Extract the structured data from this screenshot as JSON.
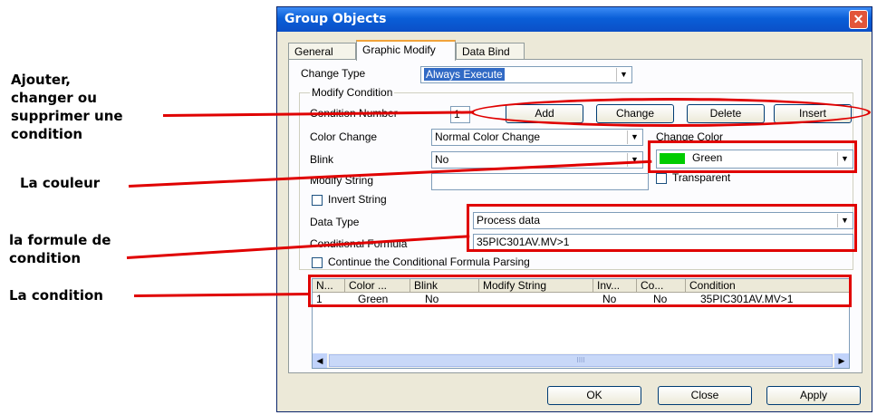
{
  "annotations": {
    "add_change_delete": "Ajouter,\nchanger ou\nsupprimer une\ncondition",
    "color": "La couleur",
    "formula": "la formule de\ncondition",
    "condition": "La condition"
  },
  "window": {
    "title": "Group Objects",
    "close_glyph": "✕"
  },
  "tabs": [
    {
      "label": "General"
    },
    {
      "label": "Graphic Modify"
    },
    {
      "label": "Data Bind"
    }
  ],
  "form": {
    "change_type_label": "Change Type",
    "change_type_value": "Always Execute",
    "modify_condition_group": "Modify Condition",
    "condition_number_label": "Condition Number",
    "condition_number_value": "1",
    "add_label": "Add",
    "change_label": "Change",
    "delete_label": "Delete",
    "insert_label": "Insert",
    "color_change_label": "Color Change",
    "color_change_value": "Normal Color Change",
    "change_color_label": "Change Color",
    "change_color_value": "Green",
    "change_color_swatch": "#00cc00",
    "blink_label": "Blink",
    "blink_value": "No",
    "transparent_label": "Transparent",
    "modify_string_label": "Modify String",
    "modify_string_value": "",
    "invert_string_label": "Invert String",
    "data_type_label": "Data Type",
    "data_type_value": "Process data",
    "conditional_formula_label": "Conditional Formula",
    "conditional_formula_value": "35PIC301AV.MV>1",
    "continue_parsing_label": "Continue the Conditional Formula Parsing"
  },
  "grid": {
    "columns": [
      "N...",
      "Color ...",
      "Blink",
      "Modify String",
      "Inv...",
      "Co...",
      "Condition"
    ],
    "rows": [
      [
        "1",
        "Green",
        "No",
        "",
        "No",
        "No",
        "35PIC301AV.MV>1"
      ]
    ],
    "scroll_thumb": "IIII"
  },
  "footer": {
    "ok_label": "OK",
    "close_label": "Close",
    "apply_label": "Apply"
  },
  "colors": {
    "annotation_red": "#e00000",
    "title_blue": "#0a5fd8",
    "selection_blue": "#316ac5"
  }
}
